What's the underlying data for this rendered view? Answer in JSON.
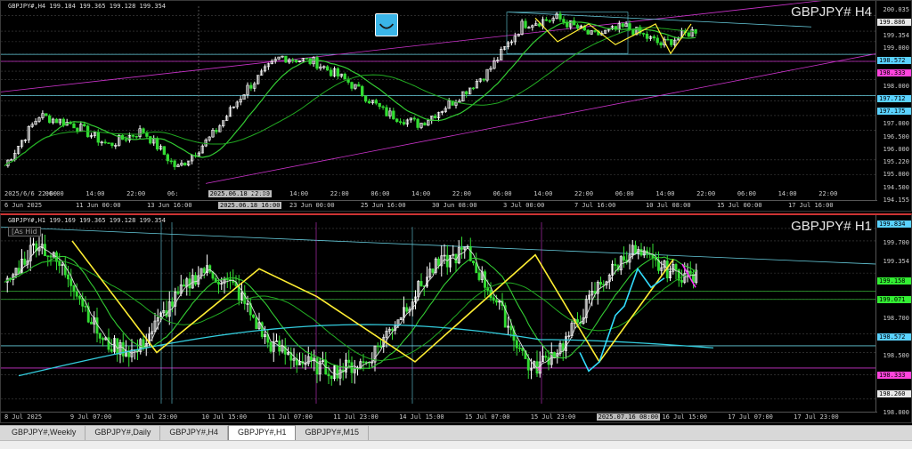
{
  "windows": {
    "h4": {
      "header": "GBPJPY#,H4  199.184 199.365 199.128 199.354",
      "title": "GBPJPY# H4",
      "price_labels": [
        "200.035",
        "199.886",
        "199.354",
        "199.000",
        "198.572",
        "198.333",
        "198.000",
        "197.712",
        "197.175",
        "197.000",
        "196.500",
        "196.000",
        "195.220",
        "195.000",
        "194.500",
        "194.155"
      ],
      "price_tags": [
        {
          "label": "199.886",
          "bg": "#e8e8e8"
        },
        {
          "label": "198.572",
          "bg": "#5ad2ff"
        },
        {
          "label": "198.333",
          "bg": "#ff44dd"
        },
        {
          "label": "197.712",
          "bg": "#5ad2ff"
        },
        {
          "label": "197.175",
          "bg": "#5ad2ff"
        }
      ],
      "time_labels": [
        "2025/6/6 22:00",
        "06:00",
        "14:00",
        "22:00",
        "06:",
        "2025.06.18 22:00",
        "06:00",
        "14:00",
        "22:00",
        "06:00",
        "14:00",
        "22:00",
        "06:00",
        "14:00",
        "22:00",
        "06:00",
        "14:00",
        "22:00",
        "06:00",
        "14:00",
        "22:00"
      ],
      "top_dates": [
        "6 Jun 2025",
        "11 Jun 00:00",
        "13 Jun 16:00",
        "2025.06.18 16:00",
        "23 Jun 00:00",
        "25 Jun 16:00",
        "30 Jun 08:00",
        "3 Jul 00:00",
        "7 Jul 16:00",
        "10 Jul 08:00",
        "15 Jul 00:00",
        "17 Jul 16:00"
      ]
    },
    "h1": {
      "header": "GBPJPY#,H1  199.169 199.365 199.128 199.354",
      "hide_label": "[As Hid",
      "title": "GBPJPY# H1",
      "price_labels": [
        "199.834",
        "199.700",
        "199.354",
        "199.158",
        "199.071",
        "198.700",
        "198.572",
        "198.500",
        "198.333",
        "198.260",
        "198.000"
      ],
      "price_tags": [
        {
          "label": "199.834",
          "bg": "#5ad2ff"
        },
        {
          "label": "199.158",
          "bg": "#33ee33"
        },
        {
          "label": "199.071",
          "bg": "#33ee33"
        },
        {
          "label": "198.572",
          "bg": "#5ad2ff"
        },
        {
          "label": "198.333",
          "bg": "#ff44dd"
        },
        {
          "label": "198.260",
          "bg": "#e8e8e8"
        }
      ],
      "time_labels": [
        "2025/7/8 05:00",
        "13:00",
        "21:00",
        "05:00",
        "13:00",
        "21:00",
        "05:00",
        "13:00",
        "21:00",
        "05:00",
        "13:00",
        "21:00",
        "05:00",
        "13:00",
        "21:00",
        "2025.07.16 14:00",
        "21:00",
        "05:00",
        "13:00",
        "21:00",
        "05:00"
      ],
      "bottom_dates": [
        "8 Jul 2025",
        "9 Jul 07:00",
        "9 Jul 23:00",
        "10 Jul 15:00",
        "11 Jul 07:00",
        "11 Jul 23:00",
        "14 Jul 15:00",
        "15 Jul 07:00",
        "15 Jul 23:00",
        "2025.07.16 08:00",
        "16 Jul 15:00",
        "17 Jul 07:00",
        "17 Jul 23:00"
      ]
    }
  },
  "tabs": [
    "GBPJPY#,Weekly",
    "GBPJPY#,Daily",
    "GBPJPY#,H4",
    "GBPJPY#,H1",
    "GBPJPY#,M15"
  ],
  "active_tab": 3,
  "colors": {
    "bull": "#ffffff",
    "bear": "#33dd33",
    "ma_green": "#33cc33",
    "ma_cyan": "#33ccdd",
    "zigzag": "#ffee33",
    "channel": "#cc33cc",
    "trend_cyan": "#66ccdd"
  }
}
